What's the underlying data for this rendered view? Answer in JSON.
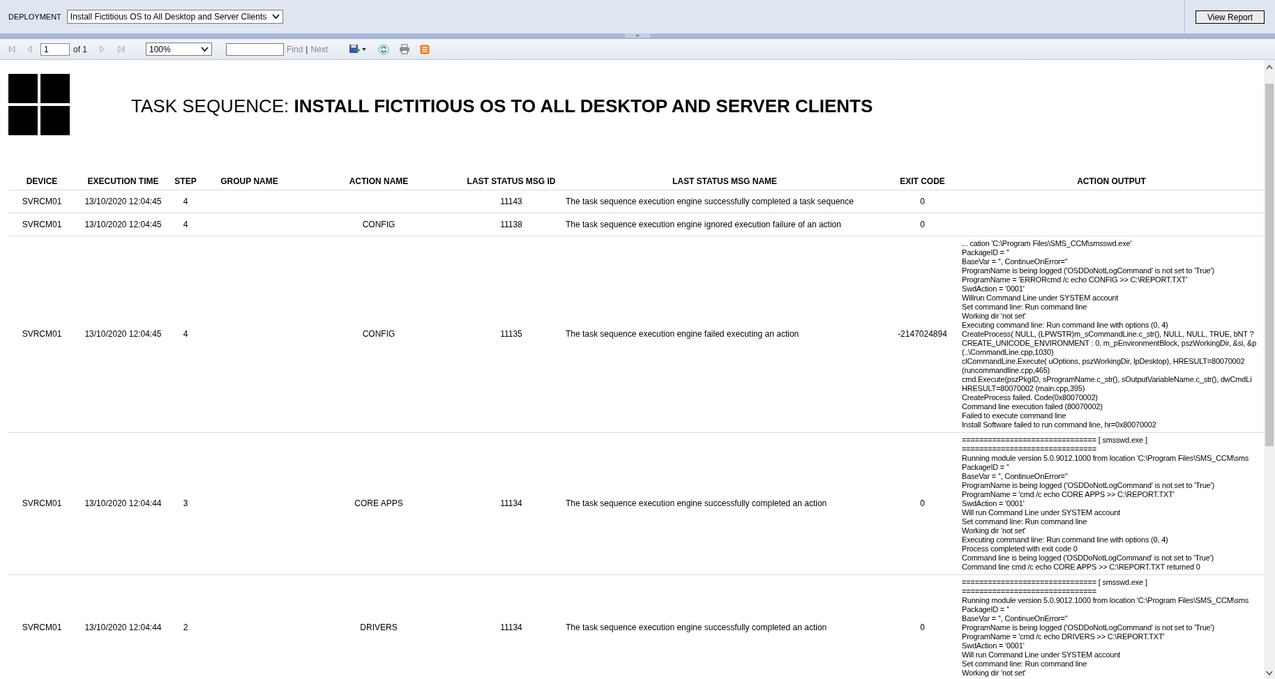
{
  "parameters": {
    "label": "DEPLOYMENT",
    "value": "Install Fictitious OS to All Desktop and Server Clients"
  },
  "view_report": "View Report",
  "toolbar": {
    "nav_first": {
      "disabled": true
    },
    "nav_prev": {
      "disabled": true
    },
    "page": "1",
    "page_count": "of 1",
    "nav_next": {
      "disabled": true
    },
    "nav_last": {
      "disabled": true
    },
    "zoom": "100%",
    "find": {
      "label": "Find",
      "disabled": true
    },
    "separator": "|",
    "next": {
      "label": "Next",
      "disabled": true
    }
  },
  "report": {
    "title": "TASK SEQUENCE: **INSTALL FICTITIOUS OS TO ALL DESKTOP AND SERVER CLIENTS**",
    "table": {
      "columns": [
        "DEVICE",
        "EXECUTION TIME",
        "STEP",
        "GROUP NAME",
        "ACTION NAME",
        "LAST STATUS MSG ID",
        "LAST STATUS MSG NAME",
        "EXIT CODE",
        "ACTION OUTPUT"
      ],
      "rows": [
        {
          "device": "SVRCM01",
          "execution_time": "13/10/2020 12:04:45",
          "step": "4",
          "action_name": "",
          "msg_id": "11143",
          "msg_name": "The task sequence execution engine successfully completed a task sequence",
          "exit_code": "0",
          "action_output": []
        },
        {
          "device": "SVRCM01",
          "execution_time": "13/10/2020 12:04:45",
          "step": "4",
          "action_name": "CONFIG",
          "msg_id": "11138",
          "msg_name": "The task sequence execution engine ignored execution failure of an action",
          "exit_code": "0",
          "action_output": []
        },
        {
          "device": "SVRCM01",
          "execution_time": "13/10/2020 12:04:45",
          "step": "4",
          "action_name": "CONFIG",
          "msg_id": "11135",
          "msg_name": "The task sequence execution engine failed executing an action",
          "exit_code": "-2147024894",
          "action_output": [
            "... cation 'C:\\Program Files\\SMS_CCM\\smsswd.exe'",
            "PackageID = ''",
            "BaseVar = '', ContinueOnError=''",
            "ProgramName is being logged ('OSDDoNotLogCommand' is not set to 'True')",
            "ProgramName = 'ERRORcmd /c echo CONFIG >> C:\\REPORT.TXT'",
            "SwdAction = '0001'",
            "Willrun Command Line under SYSTEM account",
            "Set command line: Run command line",
            "Working dir 'not set'",
            "Executing command line: Run command line with options (0, 4)",
            "CreateProcess( NULL, (LPWSTR)m_sCommandLine.c_str(), NULL, NULL, TRUE, bNT ?",
            "CREATE_UNICODE_ENVIRONMENT : 0, m_pEnvironmentBlock, pszWorkingDir, &si, &p",
            "(..\\CommandLine.cpp,1030)",
            "clCommandLine.Execute( uOptions, pszWorkingDir, lpDesktop), HRESULT=80070002",
            "(runcommandline.cpp,465)",
            "cmd.Execute(pszPkgID, sProgramName.c_str(), sOutputVariableName.c_str(), dwCmdLi",
            "HRESULT=80070002 (main.cpp,395)",
            "CreateProcess failed. Code(0x80070002)",
            "Command line execution failed (80070002)",
            "Failed to execute command line",
            "Install Software failed to run command line, hr=0x80070002"
          ]
        },
        {
          "device": "SVRCM01",
          "execution_time": "13/10/2020 12:04:44",
          "step": "3",
          "action_name": "CORE APPS",
          "msg_id": "11134",
          "msg_name": "The task sequence execution engine successfully completed an action",
          "exit_code": "0",
          "action_output": [
            "=============================== [ smsswd.exe ]",
            "===============================",
            "Running module version 5.0.9012.1000 from location 'C:\\Program Files\\SMS_CCM\\sms",
            "PackageID = ''",
            "BaseVar = '', ContinueOnError=''",
            "ProgramName is being logged ('OSDDoNotLogCommand' is not set to 'True')",
            "ProgramName = 'cmd /c echo CORE APPS >> C:\\REPORT.TXT'",
            "SwdAction = '0001'",
            "Will run Command Line under SYSTEM account",
            "Set command line: Run command line",
            "Working dir 'not set'",
            "Executing command line: Run command line with options (0, 4)",
            "Process completed with exit code 0",
            "Command line is being logged ('OSDDoNotLogCommand' is not set to 'True')",
            "Command line cmd /c echo CORE APPS >> C:\\REPORT.TXT returned 0"
          ]
        },
        {
          "device": "SVRCM01",
          "execution_time": "13/10/2020 12:04:44",
          "step": "2",
          "action_name": "DRIVERS",
          "msg_id": "11134",
          "msg_name": "The task sequence execution engine successfully completed an action",
          "exit_code": "0",
          "action_output": [
            "=============================== [ smsswd.exe ]",
            "===============================",
            "Running module version 5.0.9012.1000 from location 'C:\\Program Files\\SMS_CCM\\sms",
            "PackageID = ''",
            "BaseVar = '', ContinueOnError=''",
            "ProgramName is being logged ('OSDDoNotLogCommand' is not set to 'True')",
            "ProgramName = 'cmd /c echo DRIVERS >> C:\\REPORT.TXT'",
            "SwdAction = '0001'",
            "Will run Command Line under SYSTEM account",
            "Set command line: Run command line",
            "Working dir 'not set'"
          ]
        }
      ]
    }
  }
}
